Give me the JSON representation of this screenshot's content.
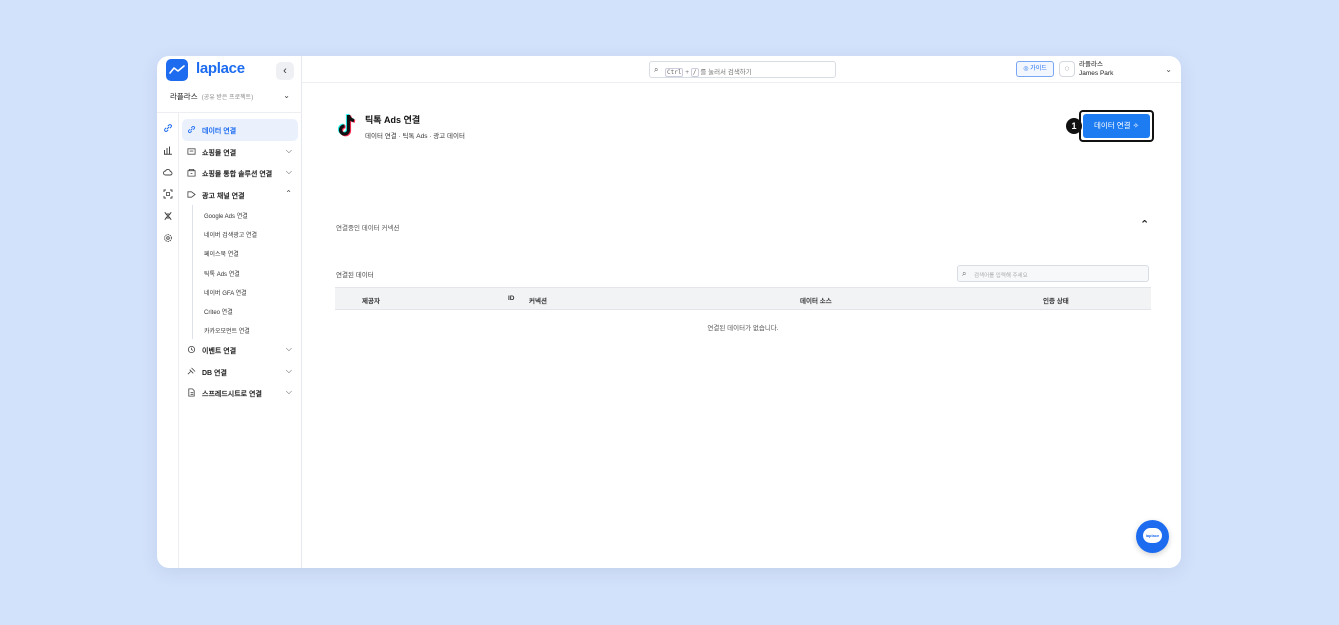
{
  "app": {
    "logo_text": "laplace",
    "collapse_glyph": "‹",
    "brand_color": "#1d6cf0"
  },
  "project": {
    "name": "라플라스",
    "note": "(공유 받은 프로젝트)"
  },
  "rail_icons": [
    "link-icon",
    "chart-icon",
    "cloud-icon",
    "scan-icon",
    "dna-icon",
    "settings-icon"
  ],
  "nav": {
    "items": [
      {
        "label": "데이터 연결",
        "icon": "link-icon",
        "active": true
      },
      {
        "label": "쇼핑몰 연결",
        "icon": "shop-icon"
      },
      {
        "label": "쇼핑몰 통합 솔루션 연결",
        "icon": "store-icon"
      },
      {
        "label": "광고 채널 연결",
        "icon": "ad-icon",
        "expanded": true
      }
    ],
    "ad_channels": [
      {
        "label": "Google Ads 연결"
      },
      {
        "label": "네이버 검색광고 연결"
      },
      {
        "label": "페이스북 연결"
      },
      {
        "label": "틱톡 Ads 연결"
      },
      {
        "label": "네이버 GFA 연결"
      },
      {
        "label": "Criteo 연결"
      },
      {
        "label": "카카오모먼트 연결"
      }
    ],
    "bottom_items": [
      {
        "label": "이벤트 연결",
        "icon": "event-icon"
      },
      {
        "label": "DB 연결",
        "icon": "database-icon"
      },
      {
        "label": "스프레드시트로 연결",
        "icon": "spreadsheet-icon"
      }
    ]
  },
  "topbar": {
    "search_key1": "Ctrl",
    "search_plus": "+",
    "search_key2": "/",
    "search_text": "를 눌러서 검색하기",
    "guide_label": "가이드",
    "user_org": "라플라스",
    "user_name": "James Park"
  },
  "page": {
    "title": "틱톡 Ads 연결",
    "breadcrumb": "데이터 연결 · 틱톡 Ads · 광고 데이터",
    "connect_button": "데이터 연결",
    "step_badge": "1",
    "connecting_section": "연결중인 데이터 커넥션",
    "connected_label": "연결된 데이터",
    "search_placeholder": "검색어를 입력해 주세요",
    "table_headers": {
      "provider": "제공자",
      "id": "ID",
      "connection": "커넥션",
      "source": "데이터 소스",
      "auth": "인증 상태"
    },
    "empty_message": "연결된 데이터가 없습니다."
  },
  "fab": {
    "label": "laplace"
  }
}
